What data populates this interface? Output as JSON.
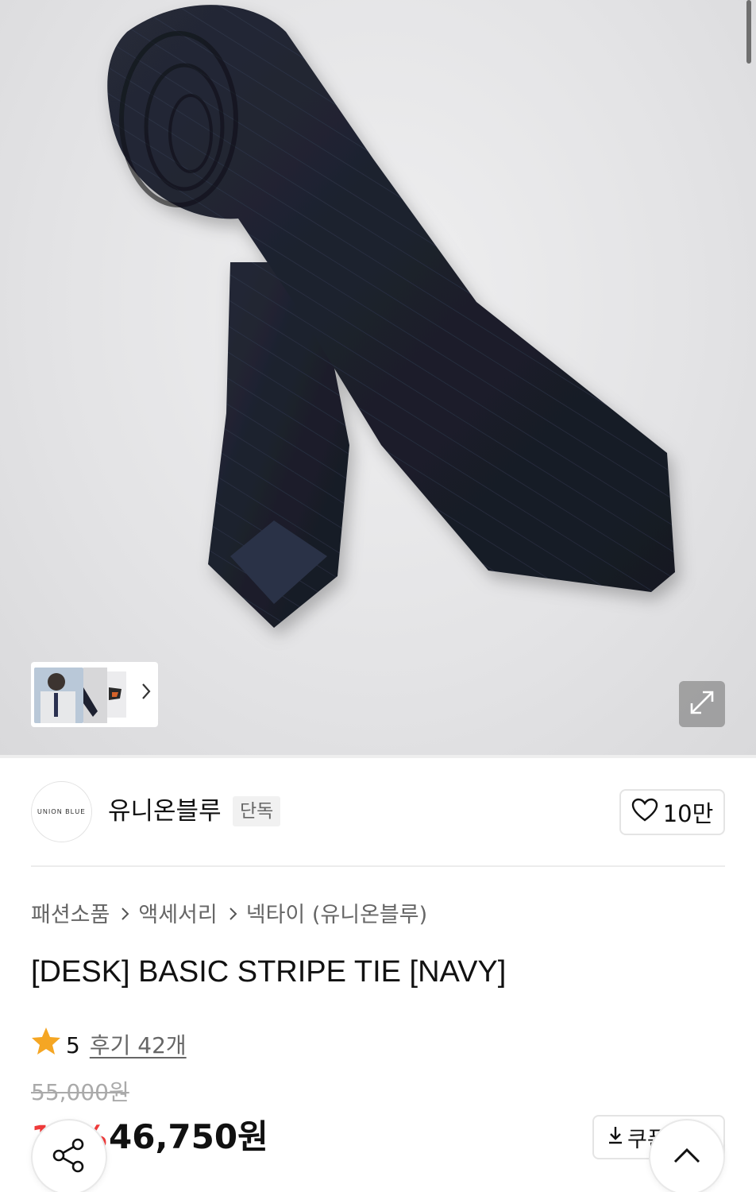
{
  "brand": {
    "logo_text": "UNION BLUE",
    "name": "유니온블루",
    "badge": "단독",
    "likes": "10만"
  },
  "breadcrumb": [
    "패션소품",
    "액세서리",
    "넥타이 (유니온블루)"
  ],
  "product": {
    "title": "[DESK] BASIC STRIPE TIE [NAVY]",
    "rating": "5",
    "reviews": "후기 42개",
    "original_price": "55,000원",
    "discount": "15%",
    "sale_price": "46,750원"
  },
  "coupon": {
    "label": "쿠폰받기"
  },
  "icons": {
    "thumb_next": "chevron-right-icon",
    "expand": "expand-icon",
    "heart": "heart-icon",
    "star": "star-icon",
    "download": "download-icon",
    "share": "share-icon",
    "scroll_top": "chevron-up-icon"
  },
  "colors": {
    "accent_red": "#ef3a3a",
    "star": "#f5a623",
    "tie_navy": "#1d2130"
  }
}
